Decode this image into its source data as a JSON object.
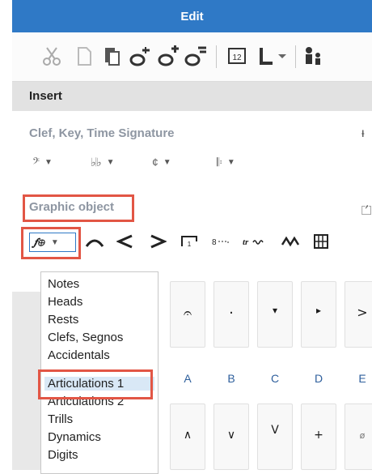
{
  "title_bar": {
    "title": "Edit"
  },
  "toolbar": {
    "icons": [
      "scissors-icon",
      "copy-icon",
      "paste-icon",
      "note-up-icon",
      "note-add-icon",
      "note-style-icon",
      "number-box-icon",
      "lyrics-L-icon",
      "people-icon"
    ]
  },
  "insert": {
    "header": "Insert",
    "clef_section": {
      "title": "Clef, Key, Time Signature",
      "combos": [
        {
          "symbol": "𝄢",
          "name": "clef-combo"
        },
        {
          "symbol": "♭𝄀♭",
          "name": "key-signature-combo"
        },
        {
          "symbol": "¢",
          "name": "time-signature-combo"
        },
        {
          "symbol": "𝄆",
          "name": "barline-combo"
        }
      ]
    },
    "graphic_section": {
      "title": "Graphic object",
      "selected_symbol": "𝆑⊕"
    }
  },
  "list": {
    "items": [
      "Notes",
      "Heads",
      "Rests",
      "Clefs, Segnos",
      "Accidentals",
      "Articulations 1",
      "Articulations 2",
      "Trills",
      "Dynamics",
      "Digits"
    ],
    "selected": "Articulations 1"
  },
  "tiles": {
    "row1_letters": [
      "A",
      "B",
      "C",
      "D",
      "E"
    ],
    "row1_glyphs": [
      "𝄐",
      "·",
      "▾",
      "▸",
      ">"
    ],
    "row2_glyphs": [
      "∧",
      "∨",
      "V",
      "+",
      "ø"
    ]
  },
  "colors": {
    "title_bar": "#2f79c6",
    "highlight_box": "#e25645",
    "section_title": "#8e96a2",
    "tile_letter": "#2e5f9c"
  }
}
